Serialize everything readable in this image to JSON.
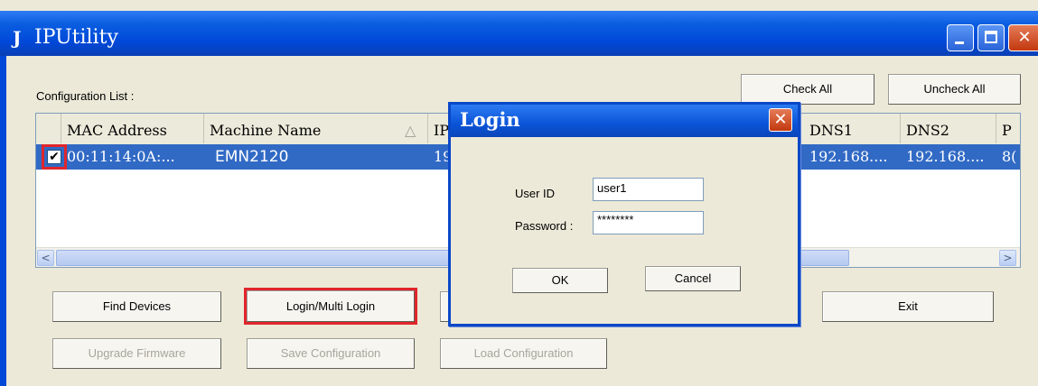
{
  "window": {
    "title": "IPUtility",
    "app_icon": "app-logo-icon",
    "minimize_icon": "minimize-icon",
    "maximize_icon": "maximize-icon",
    "close_icon": "close-icon"
  },
  "config": {
    "label": "Configuration List :",
    "check_all": "Check All",
    "uncheck_all": "Uncheck All"
  },
  "table": {
    "columns": [
      "MAC Address",
      "Machine Name",
      "IP",
      "DNS1",
      "DNS2",
      "P"
    ],
    "sort_indicator": "△",
    "row": {
      "checked": "✔",
      "mac": "00:11:14:0A:...",
      "name": "EMN2120",
      "ip": "19",
      "dns1": "192.168....",
      "dns2": "192.168....",
      "port": "8("
    },
    "scroll_left": "<",
    "scroll_right": ">"
  },
  "buttons": {
    "find_devices": "Find Devices",
    "login_multi": "Login/Multi Login",
    "exit": "Exit",
    "upgrade_firmware": "Upgrade Firmware",
    "save_configuration": "Save Configuration",
    "load_configuration": "Load Configuration"
  },
  "dialog": {
    "title": "Login",
    "close": "✕",
    "user_id_label": "User ID",
    "user_id_value": "user1",
    "password_label": "Password :",
    "password_value": "********",
    "ok": "OK",
    "cancel": "Cancel"
  },
  "colors": {
    "titlebar": "#0048d8",
    "selection": "#316ac5",
    "highlight": "#e0262b",
    "face": "#ECE9D8"
  }
}
